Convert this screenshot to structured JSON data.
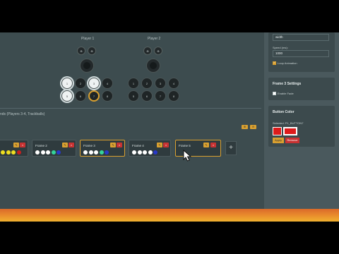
{
  "players": {
    "p1_label": "Player 1",
    "p2_label": "Player 2",
    "top_buttons": [
      "⊕",
      "⊕"
    ],
    "action_labels": [
      "1",
      "2",
      "3",
      "4",
      "5",
      "6",
      "7",
      "8"
    ]
  },
  "frames_section": {
    "label": "nds (Players 3-4, Trackballs)",
    "header_buttons": [
      "⊕",
      "⊖"
    ],
    "frames": [
      {
        "title": "",
        "edit": "✎",
        "delete": "×"
      },
      {
        "title": "Frame 2",
        "edit": "✎",
        "delete": "×"
      },
      {
        "title": "Frame 3",
        "edit": "✎",
        "delete": "×"
      },
      {
        "title": "Frame 4",
        "edit": "✎",
        "delete": "×"
      },
      {
        "title": "Frame 5",
        "edit": "✎",
        "delete": "×"
      }
    ],
    "add_label": "+"
  },
  "right_panel": {
    "top_value": "width",
    "speed_label": "Speed (ms):",
    "speed_value": "1000",
    "loop_label": "Loop Animation",
    "frame_settings_title": "Frame 3 Settings",
    "enable_fade_label": "Enable Fade",
    "button_color_title": "Button Color",
    "selected_text": "Selected: P1_BUTTON7",
    "apply_label": "Apply",
    "remove_label": "Remove"
  },
  "colors": {
    "accent": "#d9a030",
    "danger": "#c83232",
    "swatch": "#dd1b1b"
  }
}
